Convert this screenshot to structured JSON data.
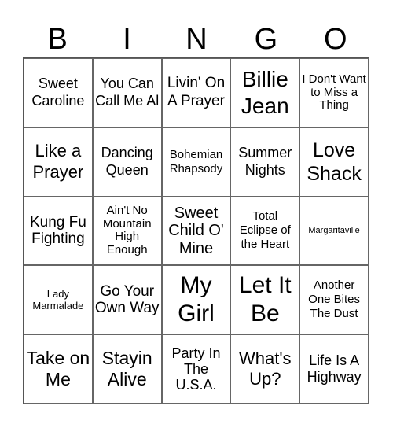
{
  "header": {
    "letters": [
      "B",
      "I",
      "N",
      "G",
      "O"
    ]
  },
  "cells": [
    [
      "Sweet Caroline",
      "You Can Call Me Al",
      "Livin' On A Prayer",
      "Billie Jean",
      "I Don't Want to Miss a Thing"
    ],
    [
      "Like a Prayer",
      "Dancing Queen",
      "Bohemian Rhapsody",
      "Summer Nights",
      "Love Shack"
    ],
    [
      "Kung Fu Fighting",
      "Ain't No Mountain High Enough",
      "Sweet Child O' Mine",
      "Total Eclipse of the Heart",
      "Margaritaville"
    ],
    [
      "Lady Marmalade",
      "Go Your Own Way",
      "My Girl",
      "Let It Be",
      "Another One Bites The Dust"
    ],
    [
      "Take on Me",
      "Stayin Alive",
      "Party In The U.S.A.",
      "What's Up?",
      "Life Is A Highway"
    ]
  ]
}
